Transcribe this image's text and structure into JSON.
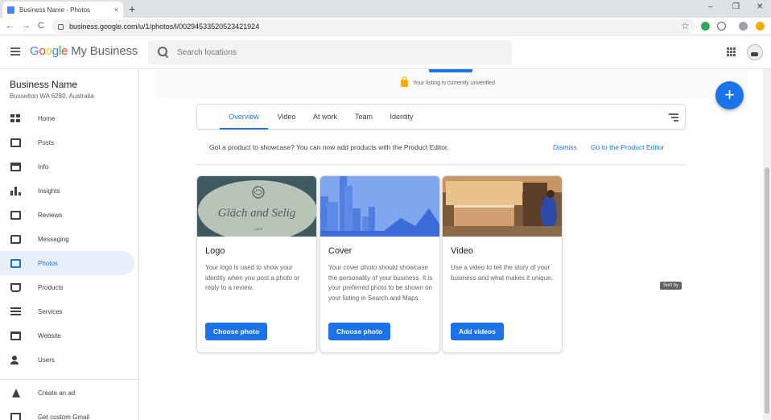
{
  "browser": {
    "tab_title": "Business Name - Photos",
    "tab_close": "×",
    "new_tab": "+",
    "url": "business.google.com/u/1/photos/l/00294533520523421924",
    "back": "←",
    "forward": "→",
    "reload": "C",
    "bookmark": "☆",
    "minimize": "–",
    "maximize": "❐",
    "close": "✕"
  },
  "header": {
    "logo_google": [
      "G",
      "o",
      "o",
      "g",
      "l",
      "e"
    ],
    "logo_product": "My Business",
    "search_placeholder": "Search locations"
  },
  "sidebar": {
    "business_name": "Business Name",
    "address": "Busselton WA 6280, Australia",
    "items": [
      {
        "label": "Home",
        "icon": "dashboard-icon"
      },
      {
        "label": "Posts",
        "icon": "posts-icon"
      },
      {
        "label": "Info",
        "icon": "storefront-icon"
      },
      {
        "label": "Insights",
        "icon": "bar-chart-icon"
      },
      {
        "label": "Reviews",
        "icon": "reviews-icon"
      },
      {
        "label": "Messaging",
        "icon": "message-icon"
      },
      {
        "label": "Photos",
        "icon": "photos-icon",
        "active": true
      },
      {
        "label": "Products",
        "icon": "basket-icon"
      },
      {
        "label": "Services",
        "icon": "list-icon"
      },
      {
        "label": "Website",
        "icon": "website-icon"
      },
      {
        "label": "Users",
        "icon": "add-user-icon"
      },
      {
        "label": "Create an ad",
        "icon": "google-ads-icon"
      },
      {
        "label": "Get custom Gmail",
        "icon": "gmail-icon"
      }
    ]
  },
  "main": {
    "listing_status": "Your listing is currently unverified",
    "fab": "+",
    "tabs": [
      "Overview",
      "Video",
      "At work",
      "Team",
      "Identity"
    ],
    "active_tab": "Overview",
    "promo_text": "Got a product to showcase? You can now add products with the Product Editor.",
    "promo_dismiss": "Dismiss",
    "promo_go": "Go to the Product Editor",
    "cards": [
      {
        "title": "Logo",
        "description": "Your logo is used to show your identity when you post a photo or reply to a review.",
        "button": "Choose photo",
        "logo_text": "Gläch and Selig",
        "logo_sub": "CAFE"
      },
      {
        "title": "Cover",
        "description": "Your cover photo should showcase the personality of your business. It is your preferred photo to be shown on your listing in Search and Maps.",
        "button": "Choose photo"
      },
      {
        "title": "Video",
        "description": "Use a video to tell the story of your business and what makes it unique.",
        "button": "Add videos"
      }
    ],
    "tooltip": "Sort by"
  },
  "colors": {
    "accent": "#1a73e8",
    "active_nav_bg": "#e8f0fe",
    "warning": "#f9ab00"
  }
}
